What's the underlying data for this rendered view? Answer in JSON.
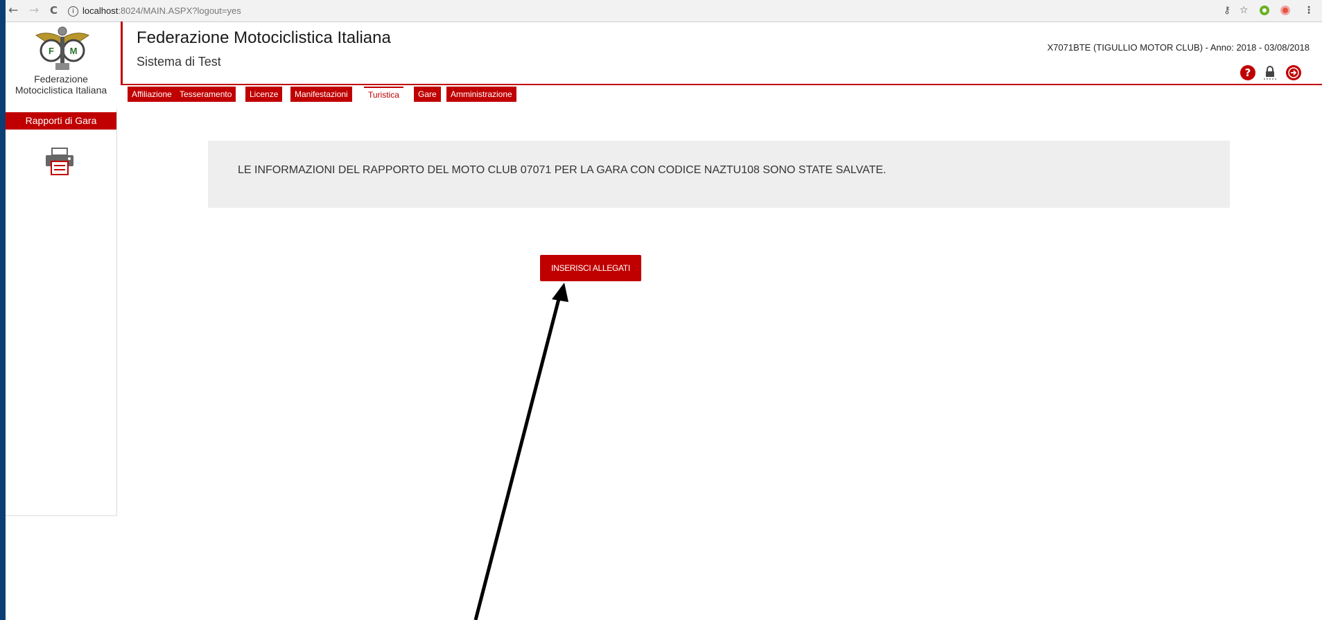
{
  "browser": {
    "back": "←",
    "forward": "→",
    "reload": "C",
    "info": "i",
    "url_host": "localhost",
    "url_rest": ":8024/MAIN.ASPX?logout=yes"
  },
  "header": {
    "logo_text": "Federazione Motociclistica Italiana",
    "title": "Federazione Motociclistica Italiana",
    "subtitle": "Sistema di Test",
    "user_info": "X7071BTE (TIGULLIO MOTOR CLUB) - Anno: 2018 - 03/08/2018",
    "icons": [
      "help-icon",
      "lock-icon",
      "logout-icon"
    ]
  },
  "tabs": [
    {
      "label": "Affiliazione",
      "active": false
    },
    {
      "label": "Tesseramento",
      "active": false
    },
    {
      "label": "Licenze",
      "active": false
    },
    {
      "label": "Manifestazioni",
      "active": false
    },
    {
      "label": "Turistica",
      "active": true
    },
    {
      "label": "Gare",
      "active": false
    },
    {
      "label": "Amministrazione",
      "active": false
    }
  ],
  "sidebar": {
    "item_label": "Rapporti di Gara",
    "print_icon": "printer-icon"
  },
  "main": {
    "message": "LE INFORMAZIONI DEL RAPPORTO DEL MOTO CLUB 07071 PER LA GARA CON CODICE NAZTU108 SONO STATE SALVATE.",
    "button_label": "INSERISCI ALLEGATI"
  },
  "colors": {
    "accent": "#c00000",
    "slide_background": "#0b3f73",
    "message_bg": "#eeeeee"
  }
}
